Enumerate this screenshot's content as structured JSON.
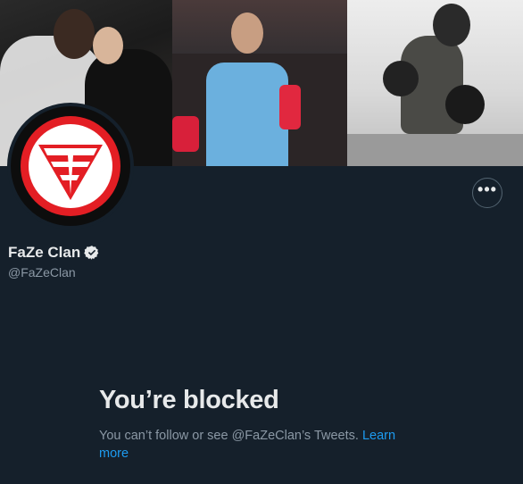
{
  "profile": {
    "display_name": "FaZe Clan",
    "handle": "@FaZeClan",
    "verified": true
  },
  "icons": {
    "more": "more-horizontal-icon",
    "verified": "verified-badge-icon",
    "avatar": "faze-logo"
  },
  "more_button": {
    "label": "•••"
  },
  "blocked": {
    "title": "You’re blocked",
    "message": "You can’t follow or see @FaZeClan’s Tweets.",
    "learn_more": "Learn more"
  },
  "colors": {
    "background": "#15202b",
    "primary_text": "#e7e9ea",
    "secondary_text": "#8b98a5",
    "link": "#1d9bf0",
    "brand_red": "#e31e24"
  }
}
